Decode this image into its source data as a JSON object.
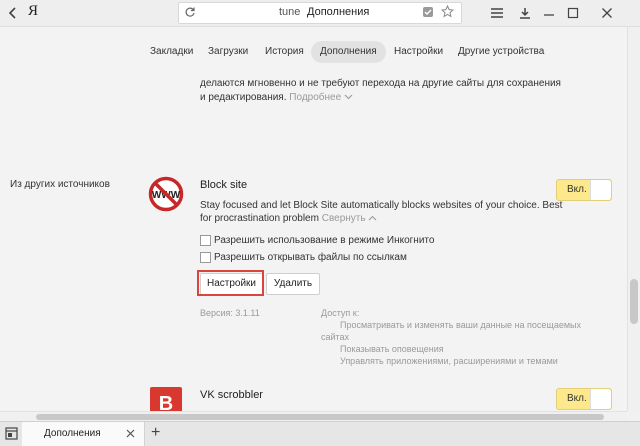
{
  "browser": {
    "brand": "Я",
    "address_host": "tune",
    "address_title": "Дополнения",
    "window_controls": [
      "minimize-icon",
      "maximize-icon",
      "close-icon"
    ]
  },
  "nav": {
    "tabs": [
      {
        "label": "Закладки",
        "active": false
      },
      {
        "label": "Загрузки",
        "active": false
      },
      {
        "label": "История",
        "active": false
      },
      {
        "label": "Дополнения",
        "active": true
      },
      {
        "label": "Настройки",
        "active": false
      },
      {
        "label": "Другие устройства",
        "active": false
      }
    ]
  },
  "prev_extension": {
    "desc_line1": "делаются мгновенно и не требуют перехода на другие сайты для сохранения",
    "desc_line2": "и редактирования.",
    "more_link": "Подробнее"
  },
  "section": {
    "title": "Из других источников"
  },
  "block_site": {
    "icon_text": "WWW",
    "name": "Block site",
    "desc_line1": "Stay focused and let Block Site automatically blocks websites of your choice. Best",
    "desc_line2": "for procrastination problem",
    "collapse_link": "Свернуть",
    "toggle_label": "Вкл.",
    "option_incognito": "Разрешить использование в режиме Инкогнито",
    "option_files": "Разрешить открывать файлы по ссылкам",
    "settings_button": "Настройки",
    "remove_button": "Удалить",
    "version": "Версия: 3.1.11",
    "access_title": "Доступ к:",
    "access_items": [
      "Просматривать и изменять ваши данные на посещаемых",
      "сайтах",
      "Показывать оповещения",
      "Управлять приложениями, расширениями и темами"
    ]
  },
  "vk_scrobbler": {
    "icon_text": "В",
    "name": "VK scrobbler",
    "toggle_label": "Вкл."
  },
  "bottom_tabs": {
    "tab_title": "Дополнения",
    "new_tab": "+"
  },
  "colors": {
    "toggle_on": "#fde98b",
    "highlight": "#d9453a",
    "vk_icon": "#d9382e",
    "prohibition": "#c62828"
  }
}
